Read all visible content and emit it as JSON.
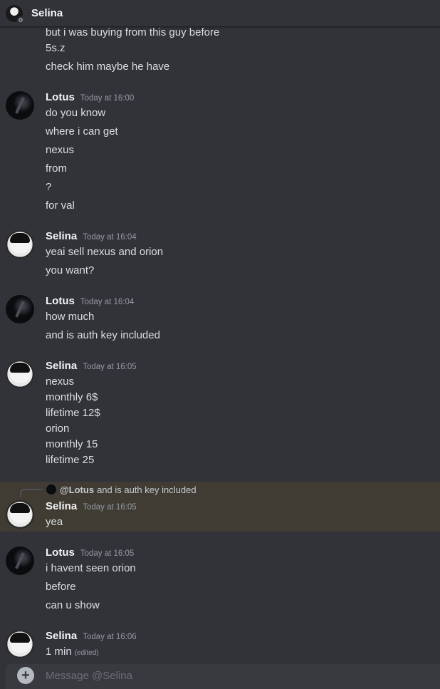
{
  "header": {
    "name": "Selina"
  },
  "messages": [
    {
      "lines": [
        "but i was buying from this guy before",
        "5s.z",
        "check him maybe he have"
      ]
    },
    {
      "author": "Lotus",
      "timestamp": "Today at 16:00",
      "lines": [
        "do you know",
        "where i can get",
        "nexus",
        "from",
        "?",
        "for val"
      ]
    },
    {
      "author": "Selina",
      "timestamp": "Today at 16:04",
      "lines": [
        "yeai sell nexus and orion",
        "you want?"
      ]
    },
    {
      "author": "Lotus",
      "timestamp": "Today at 16:04",
      "lines": [
        "how much",
        "and is auth key included"
      ]
    },
    {
      "author": "Selina",
      "timestamp": "Today at 16:05",
      "lines": [
        "nexus",
        "monthly 6$",
        "lifetime 12$",
        "orion",
        "monthly 15",
        "lifetime 25"
      ]
    },
    {
      "author": "Selina",
      "timestamp": "Today at 16:05",
      "reply": {
        "author": "@Lotus",
        "text": "and is auth key included"
      },
      "lines": [
        "yea"
      ]
    },
    {
      "author": "Lotus",
      "timestamp": "Today at 16:05",
      "lines": [
        "i havent seen orion",
        "before",
        "can u show"
      ]
    },
    {
      "author": "Selina",
      "timestamp": "Today at 16:06",
      "lines": [
        "1 min"
      ],
      "edited_label": "(edited)"
    }
  ],
  "composer": {
    "placeholder": "Message @Selina"
  }
}
